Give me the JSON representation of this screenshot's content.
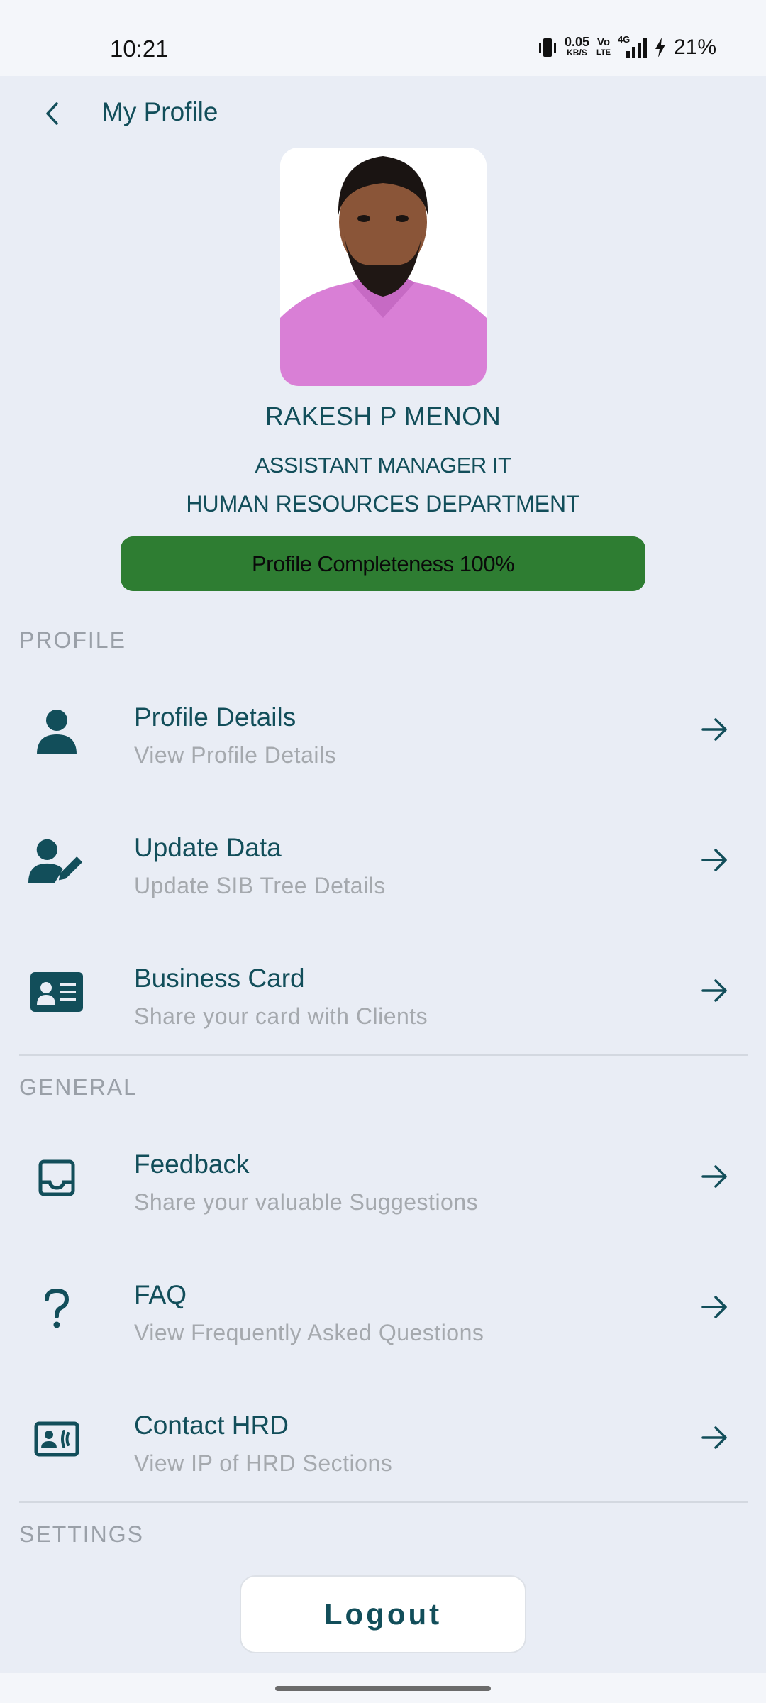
{
  "status_bar": {
    "time": "10:21",
    "net_speed_value": "0.05",
    "net_speed_unit": "KB/S",
    "volte_top": "Vo",
    "volte_bottom": "LTE",
    "network": "4G",
    "battery": "21%"
  },
  "header": {
    "title": "My Profile"
  },
  "profile": {
    "name": "RAKESH P MENON",
    "designation": "ASSISTANT MANAGER IT",
    "department": "HUMAN RESOURCES DEPARTMENT",
    "completeness_label": "Profile Completeness 100%",
    "completeness_percent": 100,
    "completeness_color": "#2e7d32"
  },
  "sections": {
    "profile": "PROFILE",
    "general": "GENERAL",
    "settings": "SETTINGS"
  },
  "menu": {
    "profile_details": {
      "label": "Profile Details",
      "sublabel": "View Profile Details",
      "icon": "person-icon"
    },
    "update_data": {
      "label": "Update Data",
      "sublabel": "Update SIB Tree Details",
      "icon": "user-edit-icon"
    },
    "business_card": {
      "label": "Business Card",
      "sublabel": "Share your card with Clients",
      "icon": "id-card-icon"
    },
    "feedback": {
      "label": "Feedback",
      "sublabel": "Share your valuable Suggestions",
      "icon": "inbox-icon"
    },
    "faq": {
      "label": "FAQ",
      "sublabel": "View Frequently Asked Questions",
      "icon": "question-icon"
    },
    "contact_hrd": {
      "label": "Contact HRD",
      "sublabel": "View IP of HRD Sections",
      "icon": "contact-phone-icon"
    }
  },
  "logout_label": "Logout",
  "colors": {
    "primary": "#124e5a",
    "background": "#e9edf5",
    "muted": "#a5a9ae",
    "success": "#2e7d32"
  }
}
